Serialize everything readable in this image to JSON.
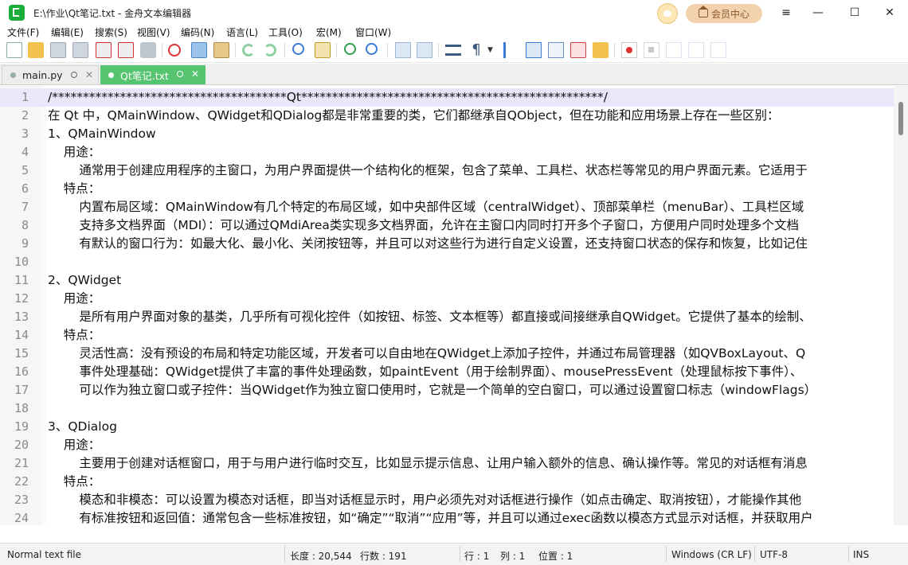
{
  "window": {
    "title": "E:\\作业\\Qt笔记.txt - 金舟文本编辑器",
    "vip_label": "会员中心",
    "minimize": "—",
    "maximize": "☐",
    "close": "✕",
    "menu_icon": "≡"
  },
  "menu": [
    {
      "label": "文件(F)"
    },
    {
      "label": "编辑(E)"
    },
    {
      "label": "搜索(S)"
    },
    {
      "label": "视图(V)"
    },
    {
      "label": "编码(N)"
    },
    {
      "label": "语言(L)"
    },
    {
      "label": "工具(O)"
    },
    {
      "label": "宏(M)"
    },
    {
      "label": "窗口(W)"
    }
  ],
  "toolbar": {
    "icons": [
      "new-file-icon",
      "open-file-icon",
      "save-icon",
      "save-all-icon",
      "close-file-icon",
      "close-all-icon",
      "print-icon",
      "cut-icon",
      "copy-icon",
      "paste-icon",
      "undo-icon",
      "redo-icon",
      "find-icon",
      "replace-icon",
      "zoom-in-icon",
      "zoom-out-icon",
      "sync-vertical-icon",
      "sync-horizontal-icon",
      "word-wrap-icon",
      "show-all-chars-icon",
      "indent-guide-icon",
      "document-map-icon",
      "function-list-icon",
      "formula-icon",
      "folder-icon",
      "record-macro-icon",
      "stop-macro-icon",
      "play-macro-icon",
      "run-macro-icon",
      "save-macro-icon"
    ]
  },
  "tabs": [
    {
      "label": "main.py",
      "active": false
    },
    {
      "label": "Qt笔记.txt",
      "active": true
    }
  ],
  "editor": {
    "lines": [
      {
        "n": "1",
        "text": "/**************************************Qt*************************************************/"
      },
      {
        "n": "2",
        "text": "在 Qt 中，QMainWindow、QWidget和QDialog都是非常重要的类，它们都继承自QObject，但在功能和应用场景上存在一些区别："
      },
      {
        "n": "3",
        "text": "1、QMainWindow"
      },
      {
        "n": "4",
        "text": "    用途："
      },
      {
        "n": "5",
        "text": "        通常用于创建应用程序的主窗口，为用户界面提供一个结构化的框架，包含了菜单、工具栏、状态栏等常见的用户界面元素。它适用于"
      },
      {
        "n": "6",
        "text": "    特点："
      },
      {
        "n": "7",
        "text": "        内置布局区域：QMainWindow有几个特定的布局区域，如中央部件区域（centralWidget）、顶部菜单栏（menuBar）、工具栏区域"
      },
      {
        "n": "8",
        "text": "        支持多文档界面（MDI）：可以通过QMdiArea类实现多文档界面，允许在主窗口内同时打开多个子窗口，方便用户同时处理多个文档"
      },
      {
        "n": "9",
        "text": "        有默认的窗口行为：如最大化、最小化、关闭按钮等，并且可以对这些行为进行自定义设置，还支持窗口状态的保存和恢复，比如记住"
      },
      {
        "n": "10",
        "text": ""
      },
      {
        "n": "11",
        "text": "2、QWidget"
      },
      {
        "n": "12",
        "text": "    用途："
      },
      {
        "n": "13",
        "text": "        是所有用户界面对象的基类，几乎所有可视化控件（如按钮、标签、文本框等）都直接或间接继承自QWidget。它提供了基本的绘制、"
      },
      {
        "n": "14",
        "text": "    特点："
      },
      {
        "n": "15",
        "text": "        灵活性高：没有预设的布局和特定功能区域，开发者可以自由地在QWidget上添加子控件，并通过布局管理器（如QVBoxLayout、Q"
      },
      {
        "n": "16",
        "text": "        事件处理基础：QWidget提供了丰富的事件处理函数，如paintEvent（用于绘制界面）、mousePressEvent（处理鼠标按下事件）、"
      },
      {
        "n": "17",
        "text": "        可以作为独立窗口或子控件：当QWidget作为独立窗口使用时，它就是一个简单的空白窗口，可以通过设置窗口标志（windowFlags）"
      },
      {
        "n": "18",
        "text": ""
      },
      {
        "n": "19",
        "text": "3、QDialog"
      },
      {
        "n": "20",
        "text": "    用途："
      },
      {
        "n": "21",
        "text": "        主要用于创建对话框窗口，用于与用户进行临时交互，比如显示提示信息、让用户输入额外的信息、确认操作等。常见的对话框有消息"
      },
      {
        "n": "22",
        "text": "    特点："
      },
      {
        "n": "23",
        "text": "        模态和非模态：可以设置为模态对话框，即当对话框显示时，用户必须先对对话框进行操作（如点击确定、取消按钮），才能操作其他"
      },
      {
        "n": "24",
        "text": "        有标准按钮和返回值：通常包含一些标准按钮，如“确定”“取消”“应用”等，并且可以通过exec函数以模态方式显示对话框，并获取用户"
      }
    ]
  },
  "status": {
    "file_type": "Normal text file",
    "length": "长度 : 20,544",
    "lines": "行数 : 191",
    "row": "行 : 1",
    "col": "列 : 1",
    "pos": "位置 : 1",
    "eol": "Windows (CR LF)",
    "encoding": "UTF-8",
    "mode": "INS"
  }
}
